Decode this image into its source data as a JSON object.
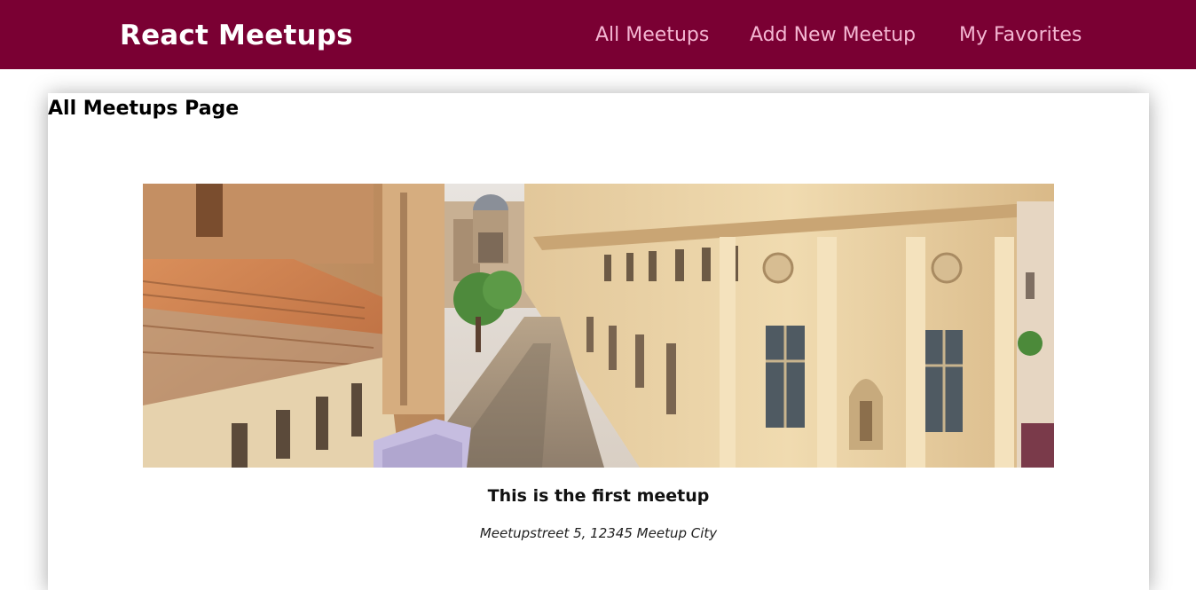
{
  "header": {
    "logo": "React Meetups",
    "nav": [
      {
        "label": "All Meetups"
      },
      {
        "label": "Add New Meetup"
      },
      {
        "label": "My Favorites"
      }
    ]
  },
  "page": {
    "title": "All Meetups Page"
  },
  "meetups": [
    {
      "title": "This is the first meetup",
      "address": "Meetupstreet 5, 12345 Meetup City"
    }
  ],
  "colors": {
    "header_bg": "#7a0033",
    "nav_text": "#f4b6d2",
    "logo_text": "#ffffff"
  }
}
